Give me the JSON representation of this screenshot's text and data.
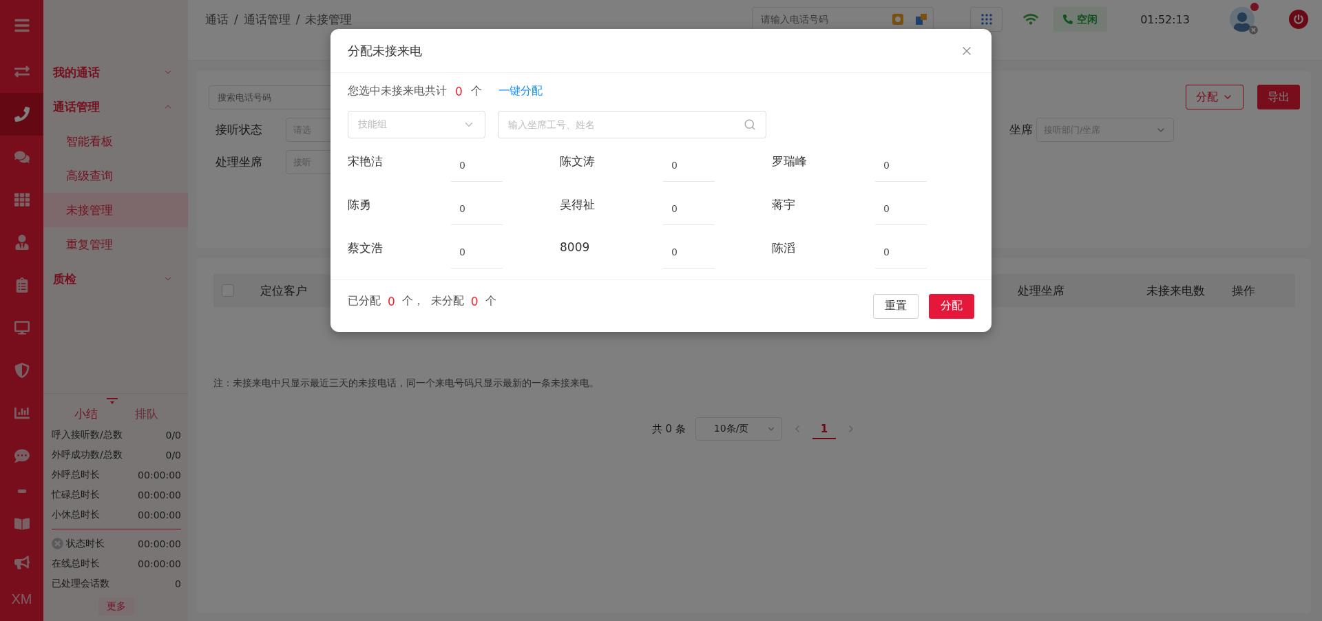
{
  "rail": {
    "items": [
      {
        "selected": false
      },
      {
        "selected": true
      },
      {
        "selected": false
      },
      {
        "selected": false
      },
      {
        "selected": false
      },
      {
        "selected": false
      },
      {
        "selected": false
      },
      {
        "selected": false
      },
      {
        "selected": false
      },
      {
        "selected": false
      },
      {
        "selected": false
      },
      {
        "selected": false
      }
    ],
    "footer": "XM"
  },
  "sidebar": {
    "groups": [
      {
        "label": "我的通话",
        "expanded": false
      },
      {
        "label": "通话管理",
        "expanded": true,
        "children": [
          {
            "label": "智能看板",
            "selected": false
          },
          {
            "label": "高级查询",
            "selected": false
          },
          {
            "label": "未接管理",
            "selected": true
          },
          {
            "label": "重复管理",
            "selected": false
          }
        ]
      },
      {
        "label": "质检",
        "expanded": false
      }
    ],
    "stats": {
      "tabs": [
        {
          "label": "小结",
          "selected": true
        },
        {
          "label": "排队",
          "selected": false
        }
      ],
      "rows": [
        {
          "label": "呼入接听数/总数",
          "value": "0/0"
        },
        {
          "label": "外呼成功数/总数",
          "value": "0/0"
        },
        {
          "label": "外呼总时长",
          "value": "00:00:00"
        },
        {
          "label": "忙碌总时长",
          "value": "00:00:00"
        },
        {
          "label": "小休总时长",
          "value": "00:00:00"
        }
      ],
      "status_rows": [
        {
          "label": "状态时长",
          "value": "00:00:00",
          "kind": "clearable"
        },
        {
          "label": "在线总时长",
          "value": "00:00:00",
          "kind": "plain"
        },
        {
          "label": "已处理会话数",
          "value": "0",
          "kind": "plain"
        }
      ],
      "more_button": "更多"
    }
  },
  "header": {
    "breadcrumb": [
      "通话",
      "通话管理",
      "未接管理"
    ],
    "breadcrumb_separator": "/",
    "search": {
      "placeholder": "请输入电话号码"
    },
    "status": {
      "label": "空闲"
    },
    "time": "01:52:13",
    "avatar": {
      "unread": true,
      "offline": true
    }
  },
  "filters": {
    "search": {
      "placeholder": "搜索电话号码"
    },
    "fields": [
      {
        "label": "接听状态",
        "placeholder": "请选"
      },
      {
        "label": "处理坐席",
        "placeholder": "接听"
      }
    ],
    "right_field": {
      "label": "坐席",
      "placeholder": "接听部门/坐席"
    },
    "buttons": [
      {
        "label": "分配",
        "kind": "dropdown"
      },
      {
        "label": "导出",
        "kind": "primary"
      }
    ]
  },
  "table": {
    "select_all": {
      "checked": false
    },
    "columns": [
      "定位客户",
      "处理坐席",
      "未接来电数",
      "操作"
    ],
    "note": "注：未接来电中只显示最近三天的未接电话，同一个来电号码只显示最新的一条未接来电。",
    "pagination": {
      "total": "共 0 条",
      "page_size": "10条/页",
      "pages": [
        {
          "label": "1",
          "selected": true
        }
      ]
    }
  },
  "dialog": {
    "title": "分配未接来电",
    "summary": {
      "text": "您选中未接来电共计",
      "count": "0",
      "unit": "个",
      "link": "一键分配"
    },
    "skill_select": {
      "placeholder": "技能组"
    },
    "agent_search": {
      "placeholder": "输入坐席工号、姓名"
    },
    "agents": [
      {
        "name": "宋艳洁",
        "value": "0"
      },
      {
        "name": "陈文涛",
        "value": "0"
      },
      {
        "name": "罗瑞峰",
        "value": "0"
      },
      {
        "name": "陈勇",
        "value": "0"
      },
      {
        "name": "吴得祉",
        "value": "0"
      },
      {
        "name": "蒋宇",
        "value": "0"
      },
      {
        "name": "蔡文浩",
        "value": "0"
      },
      {
        "name": "8009",
        "value": "0"
      },
      {
        "name": "陈滔",
        "value": "0"
      }
    ],
    "footer": {
      "assigned_label": "已分配",
      "assigned": "0",
      "assigned_unit": "个，",
      "unassigned_label": "未分配",
      "unassigned": "0",
      "unassigned_unit": "个"
    },
    "buttons": [
      {
        "label": "重置",
        "kind": "default"
      },
      {
        "label": "分配",
        "kind": "primary"
      }
    ]
  }
}
